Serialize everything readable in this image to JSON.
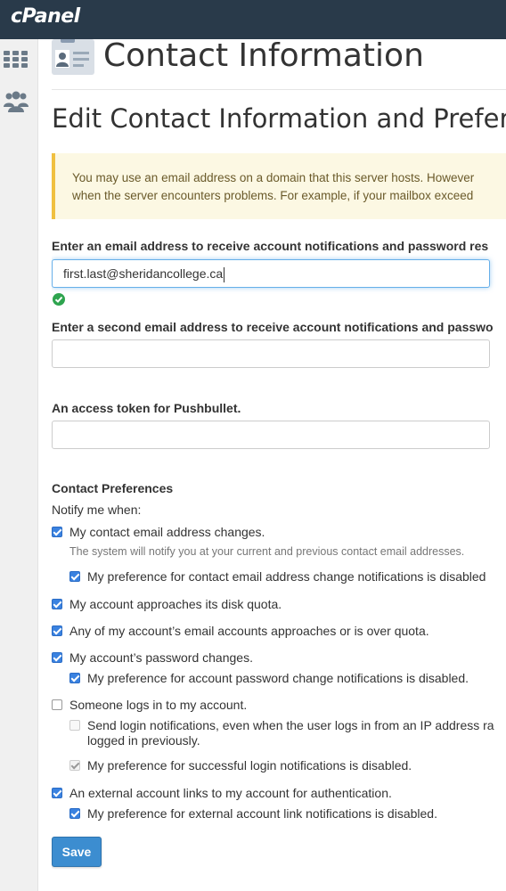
{
  "app": {
    "logo": "cPanel"
  },
  "sidebar": {
    "items": [
      {
        "icon": "grid-icon"
      },
      {
        "icon": "users-icon"
      }
    ]
  },
  "page": {
    "title": "Contact Information",
    "section_title": "Edit Contact Information and Prefere",
    "alert_line1": "You may use an email address on a domain that this server hosts. However",
    "alert_line2": "when the server encounters problems. For example, if your mailbox exceed"
  },
  "form": {
    "email1_label": "Enter an email address to receive account notifications and password res",
    "email1_value": "first.last@sheridancollege.ca",
    "email2_label": "Enter a second email address to receive account notifications and passwo",
    "email2_value": "",
    "pushbullet_label": "An access token for Pushbullet.",
    "pushbullet_value": ""
  },
  "preferences": {
    "heading": "Contact Preferences",
    "notify_label": "Notify me when:",
    "contact_change": "My contact email address changes.",
    "contact_change_help": "The system will notify you at your current and previous contact email addresses.",
    "contact_change_disabled": "My preference for contact email address change notifications is disabled",
    "disk_quota": "My account approaches its disk quota.",
    "email_quota": "Any of my account’s email accounts approaches or is over quota.",
    "password_change": "My account’s password changes.",
    "password_change_disabled": "My preference for account password change notifications is disabled.",
    "login": "Someone logs in to my account.",
    "login_sub_line1": "Send login notifications, even when the user logs in from an IP address ra",
    "login_sub_line2": "logged in previously.",
    "login_disabled": "My preference for successful login notifications is disabled.",
    "external_link": "An external account links to my account for authentication.",
    "external_link_disabled": "My preference for external account link notifications is disabled."
  },
  "actions": {
    "save_label": "Save"
  },
  "colors": {
    "topbar": "#293a4a",
    "primary": "#3c8dd0",
    "alert_border": "#f0c040",
    "success": "#2ea44f"
  }
}
